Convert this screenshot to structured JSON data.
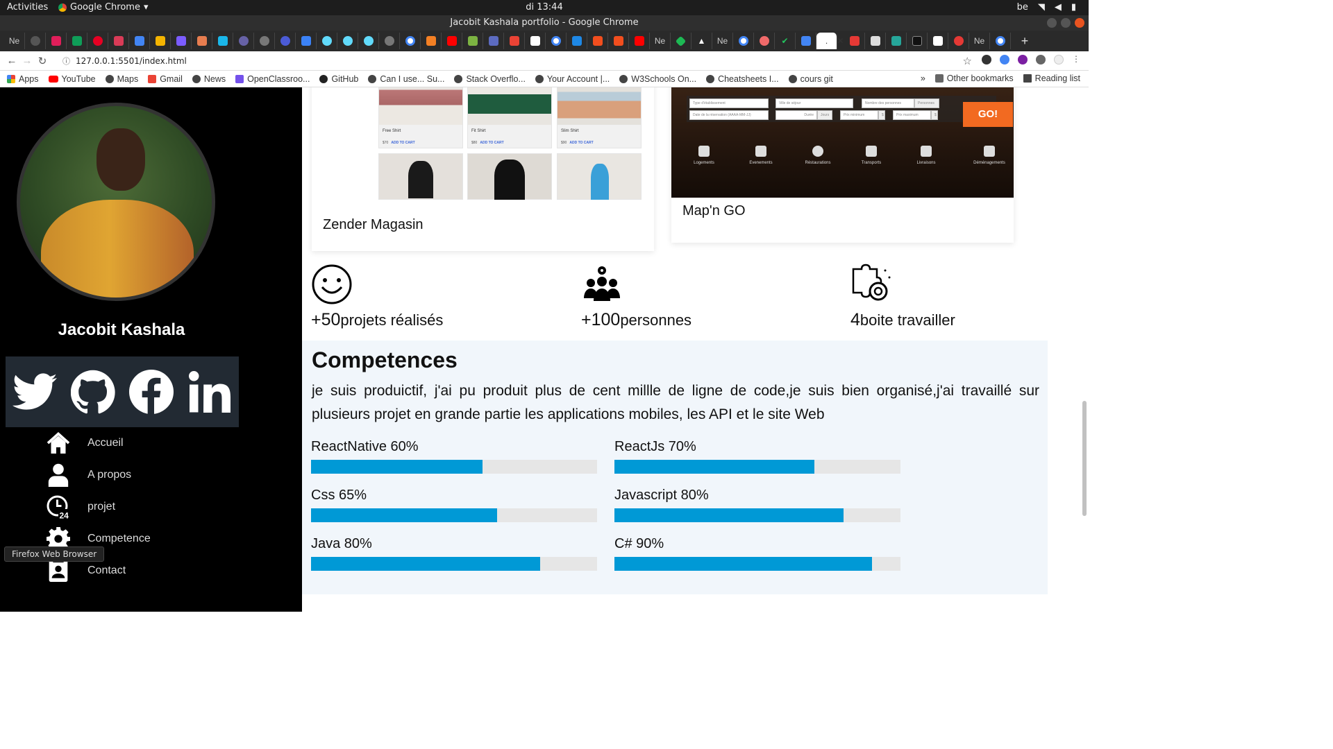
{
  "os": {
    "activities": "Activities",
    "app_name": "Google Chrome",
    "clock": "di 13:44",
    "keyboard": "be"
  },
  "window": {
    "title": "Jacobit Kashala portfolio - Google Chrome"
  },
  "tabs": {
    "labels": [
      "Ne",
      "Ne",
      "Ne",
      "Ne"
    ],
    "active_label": "."
  },
  "toolbar": {
    "url": "127.0.0.1:5501/index.html"
  },
  "bookmarks": {
    "items": [
      "Apps",
      "YouTube",
      "Maps",
      "Gmail",
      "News",
      "OpenClassroo...",
      "GitHub",
      "Can I use... Su...",
      "Stack Overflo...",
      "Your Account |...",
      "W3Schools On...",
      "Cheatsheets I...",
      "cours git"
    ],
    "overflow": "»",
    "other": "Other bookmarks",
    "reading": "Reading list"
  },
  "sidebar": {
    "name": "Jacobit Kashala",
    "menu": [
      {
        "label": "Accueil",
        "icon": "home-icon"
      },
      {
        "label": "A propos",
        "icon": "user-icon"
      },
      {
        "label": "projet",
        "icon": "clock-24-icon"
      },
      {
        "label": "Competence",
        "icon": "gear-icon"
      },
      {
        "label": "Contact",
        "icon": "contact-card-icon"
      }
    ],
    "tooltip": "Firefox Web Browser"
  },
  "projects": [
    {
      "title": "Zender Magasin",
      "products": [
        {
          "name": "Free Shirt",
          "price": "$70",
          "cta": "ADD TO CART"
        },
        {
          "name": "Fit Shirt",
          "price": "$80",
          "cta": "ADD TO CART"
        },
        {
          "name": "Slim Shirt",
          "price": "$90",
          "cta": "ADD TO CART"
        }
      ]
    },
    {
      "title": "Map'n GO",
      "fields": [
        "Type d'établissement",
        "Ville de séjour",
        "Nombre des personnes",
        "Personnes",
        "Date de la réservation (AAAA-MM-JJ)",
        "Durée",
        "Jours",
        "Prix minimum",
        "$",
        "Prix maximum",
        "$"
      ],
      "go": "GO!",
      "categories": [
        "Logements",
        "Evenements",
        "Réstaurations",
        "Transports",
        "Livraisons",
        "Déménagements"
      ]
    }
  ],
  "stats": [
    {
      "num": "+50",
      "label": "projets réalisés",
      "icon": "smiley-icon"
    },
    {
      "num": "+100",
      "label": "personnes",
      "icon": "team-gear-icon"
    },
    {
      "num": "4",
      "label": "boite travailler",
      "icon": "puzzle-gear-icon"
    }
  ],
  "competences": {
    "title": "Competences",
    "text": "je suis produictif, j'ai pu produit plus de cent millle de ligne de code,je suis bien organisé,j'ai travaillé sur plusieurs projet en grande partie les applications mobiles, les API et le site Web",
    "skills": [
      {
        "label": "ReactNative 60%",
        "percent": 60
      },
      {
        "label": "ReactJs 70%",
        "percent": 70
      },
      {
        "label": "Css 65%",
        "percent": 65
      },
      {
        "label": "Javascript 80%",
        "percent": 80
      },
      {
        "label": "Java 80%",
        "percent": 80
      },
      {
        "label": "C# 90%",
        "percent": 90
      }
    ],
    "bar_color": "#0099d6"
  }
}
